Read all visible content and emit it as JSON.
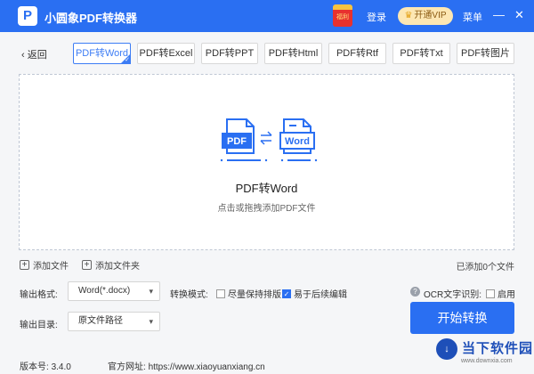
{
  "app": {
    "title": "小圆象PDF转换器",
    "logo_letter": "P"
  },
  "titlebar": {
    "gift_label": "福利",
    "login": "登录",
    "vip": "开通VIP",
    "menu": "菜单",
    "minimize": "—",
    "close": "✕"
  },
  "nav": {
    "back": "返回"
  },
  "tabs": [
    {
      "label": "PDF转Word",
      "active": true
    },
    {
      "label": "PDF转Excel"
    },
    {
      "label": "PDF转PPT"
    },
    {
      "label": "PDF转Html"
    },
    {
      "label": "PDF转Rtf"
    },
    {
      "label": "PDF转Txt"
    },
    {
      "label": "PDF转图片"
    }
  ],
  "dropzone": {
    "art_from": "PDF",
    "art_to": "Word",
    "title": "PDF转Word",
    "hint": "点击或拖拽添加PDF文件"
  },
  "actions": {
    "add_file": "添加文件",
    "add_folder": "添加文件夹",
    "added_count": "已添加0个文件"
  },
  "options": {
    "format_label": "输出格式:",
    "format_value": "Word(*.docx)",
    "mode_label": "转换模式:",
    "mode_option1": "尽量保持排版",
    "mode_option1_checked": false,
    "mode_option2": "易于后续编辑",
    "mode_option2_checked": true,
    "ocr_label": "OCR文字识别:",
    "ocr_enable": "启用",
    "ocr_checked": false,
    "dir_label": "输出目录:",
    "dir_value": "原文件路径",
    "start": "开始转换"
  },
  "footer": {
    "version_label": "版本号:",
    "version": "3.4.0",
    "site_label": "官方网址:",
    "site": "https://www.xiaoyuanxiang.cn"
  },
  "watermark": {
    "badge": "↓",
    "text": "当下软件园",
    "url": "www.downxia.com"
  },
  "colors": {
    "primary": "#2a6ff2",
    "vip_bg": "#fde7b3",
    "gift": "#e8312f"
  }
}
